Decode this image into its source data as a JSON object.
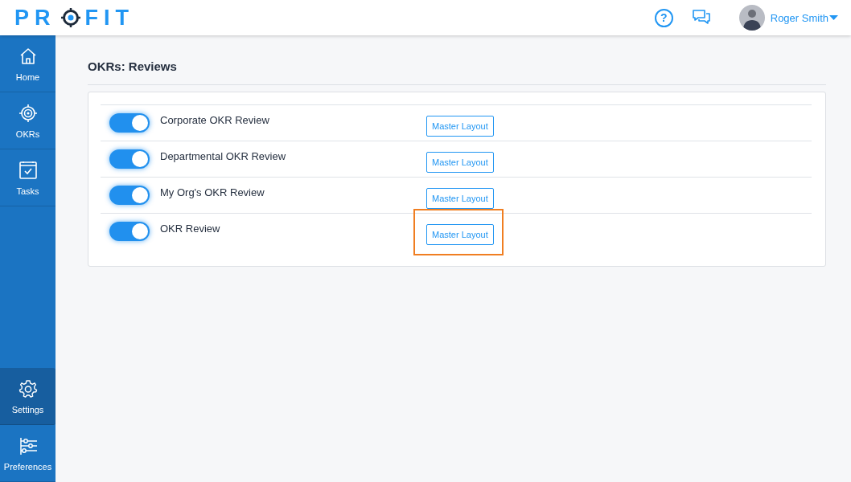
{
  "logo": {
    "before": "PR",
    "after": "FIT"
  },
  "header": {
    "help_glyph": "?",
    "user_name": "Roger Smith"
  },
  "sidebar": {
    "items": [
      {
        "label": "Home",
        "selected": false
      },
      {
        "label": "OKRs",
        "selected": false
      },
      {
        "label": "Tasks",
        "selected": false
      }
    ],
    "bottom_items": [
      {
        "label": "Settings",
        "selected": true
      },
      {
        "label": "Preferences",
        "selected": false
      }
    ]
  },
  "page": {
    "title": "OKRs: Reviews"
  },
  "reviews": [
    {
      "name": "Corporate OKR Review",
      "on": true,
      "button": "Master Layout",
      "highlighted": false
    },
    {
      "name": "Departmental OKR Review",
      "on": true,
      "button": "Master Layout",
      "highlighted": false
    },
    {
      "name": "My Org's OKR Review",
      "on": true,
      "button": "Master Layout",
      "highlighted": false
    },
    {
      "name": "OKR Review",
      "on": true,
      "button": "Master Layout",
      "highlighted": true
    }
  ]
}
